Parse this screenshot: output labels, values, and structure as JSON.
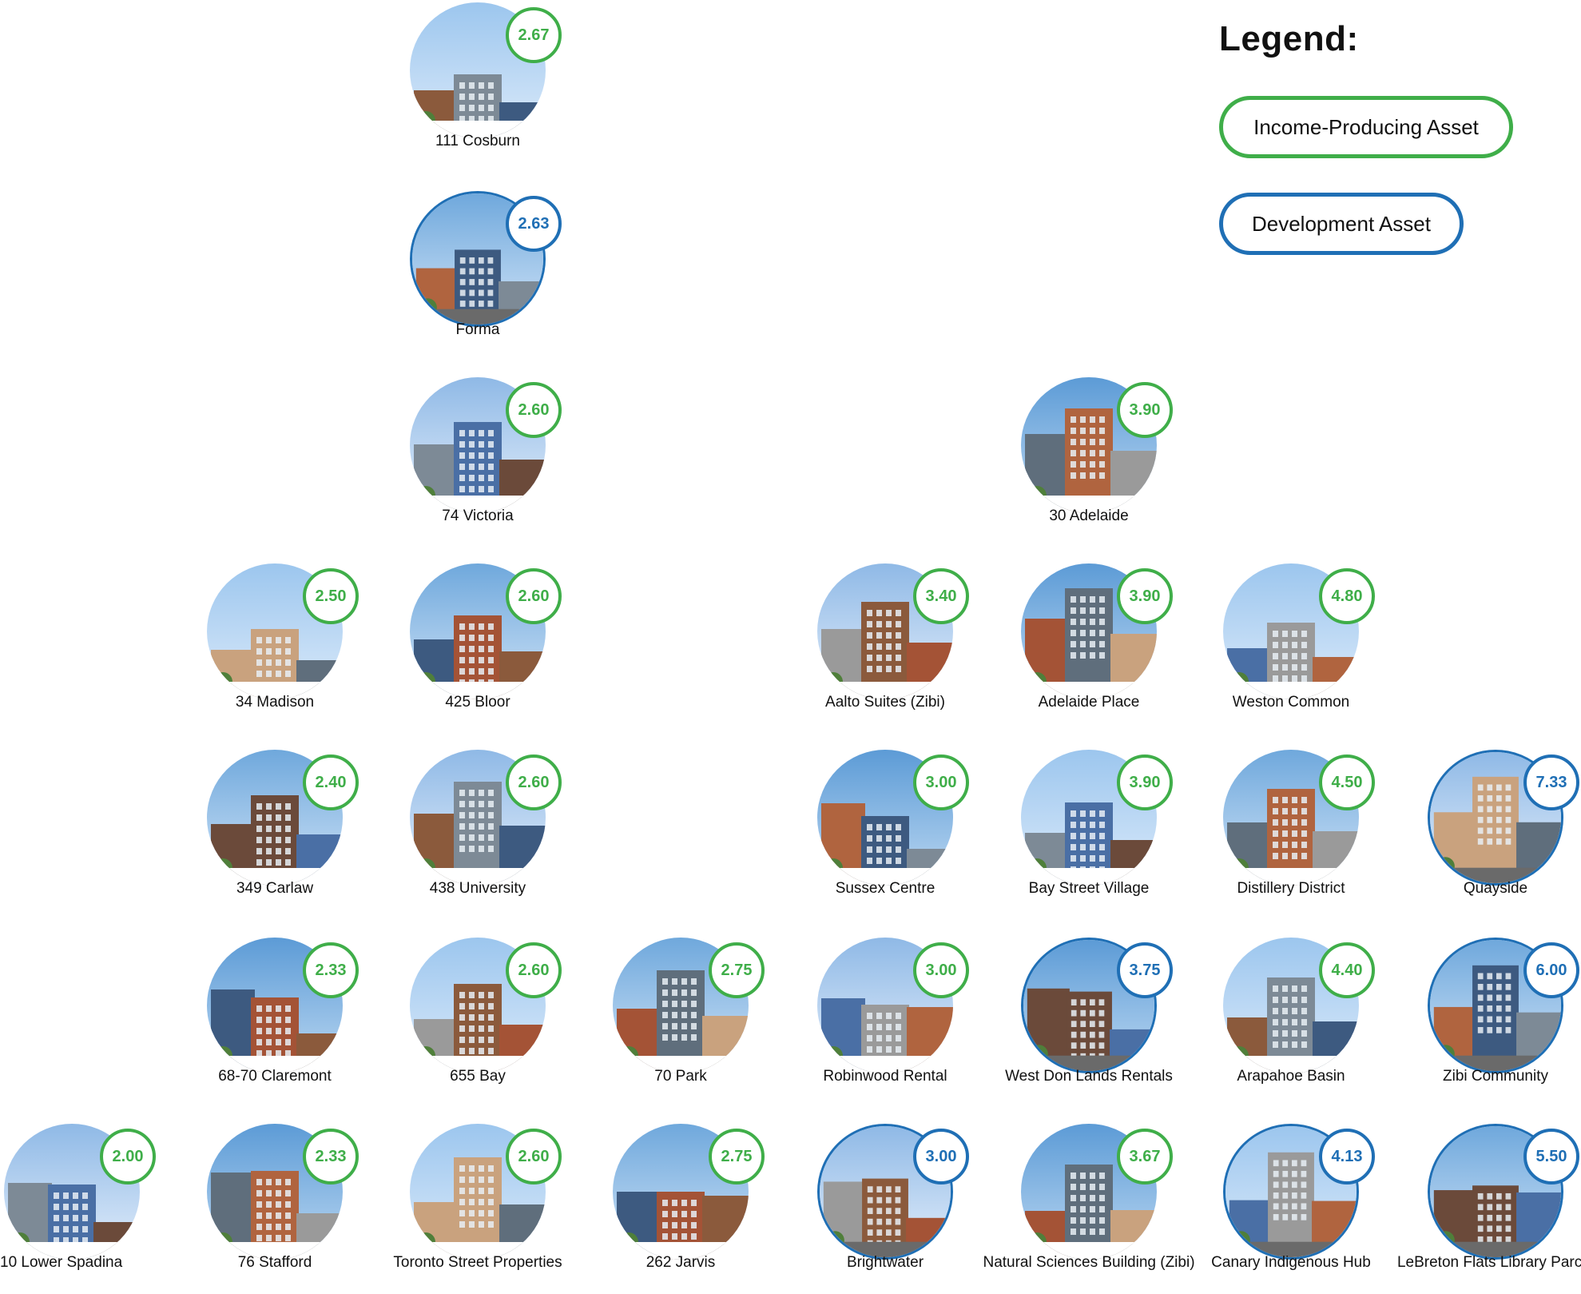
{
  "legend": {
    "title": "Legend:",
    "items": [
      {
        "label": "Income-Producing Asset",
        "color": "#3fae49"
      },
      {
        "label": "Development Asset",
        "color": "#1f6fb5"
      }
    ]
  },
  "assets": [
    {
      "name": "111 Cosburn",
      "rating": "2.67",
      "kind": "income"
    },
    {
      "name": "Forma",
      "rating": "2.63",
      "kind": "development"
    },
    {
      "name": "74 Victoria",
      "rating": "2.60",
      "kind": "income"
    },
    {
      "name": "30 Adelaide",
      "rating": "3.90",
      "kind": "income"
    },
    {
      "name": "34 Madison",
      "rating": "2.50",
      "kind": "income"
    },
    {
      "name": "425 Bloor",
      "rating": "2.60",
      "kind": "income"
    },
    {
      "name": "Aalto Suites (Zibi)",
      "rating": "3.40",
      "kind": "income"
    },
    {
      "name": "Adelaide Place",
      "rating": "3.90",
      "kind": "income"
    },
    {
      "name": "Weston Common",
      "rating": "4.80",
      "kind": "income"
    },
    {
      "name": "349 Carlaw",
      "rating": "2.40",
      "kind": "income"
    },
    {
      "name": "438 University",
      "rating": "2.60",
      "kind": "income"
    },
    {
      "name": "Sussex Centre",
      "rating": "3.00",
      "kind": "income"
    },
    {
      "name": "Bay Street Village",
      "rating": "3.90",
      "kind": "income"
    },
    {
      "name": "Distillery District",
      "rating": "4.50",
      "kind": "income"
    },
    {
      "name": "Quayside",
      "rating": "7.33",
      "kind": "development"
    },
    {
      "name": "68-70 Claremont",
      "rating": "2.33",
      "kind": "income"
    },
    {
      "name": "655 Bay",
      "rating": "2.60",
      "kind": "income"
    },
    {
      "name": "70 Park",
      "rating": "2.75",
      "kind": "income"
    },
    {
      "name": "Robinwood Rental",
      "rating": "3.00",
      "kind": "income"
    },
    {
      "name": "West Don Lands Rentals",
      "rating": "3.75",
      "kind": "development"
    },
    {
      "name": "Arapahoe Basin",
      "rating": "4.40",
      "kind": "income"
    },
    {
      "name": "Zibi Community",
      "rating": "6.00",
      "kind": "development"
    },
    {
      "name": "10 Lower Spadina",
      "rating": "2.00",
      "kind": "income"
    },
    {
      "name": "76 Stafford",
      "rating": "2.33",
      "kind": "income"
    },
    {
      "name": "Toronto Street Properties",
      "rating": "2.60",
      "kind": "income"
    },
    {
      "name": "262 Jarvis",
      "rating": "2.75",
      "kind": "income"
    },
    {
      "name": "Brightwater",
      "rating": "3.00",
      "kind": "development"
    },
    {
      "name": "Natural Sciences Building (Zibi)",
      "rating": "3.67",
      "kind": "income"
    },
    {
      "name": "Canary Indigenous Hub",
      "rating": "4.13",
      "kind": "development"
    },
    {
      "name": "LeBreton Flats Library Parcel",
      "rating": "5.50",
      "kind": "development"
    }
  ]
}
